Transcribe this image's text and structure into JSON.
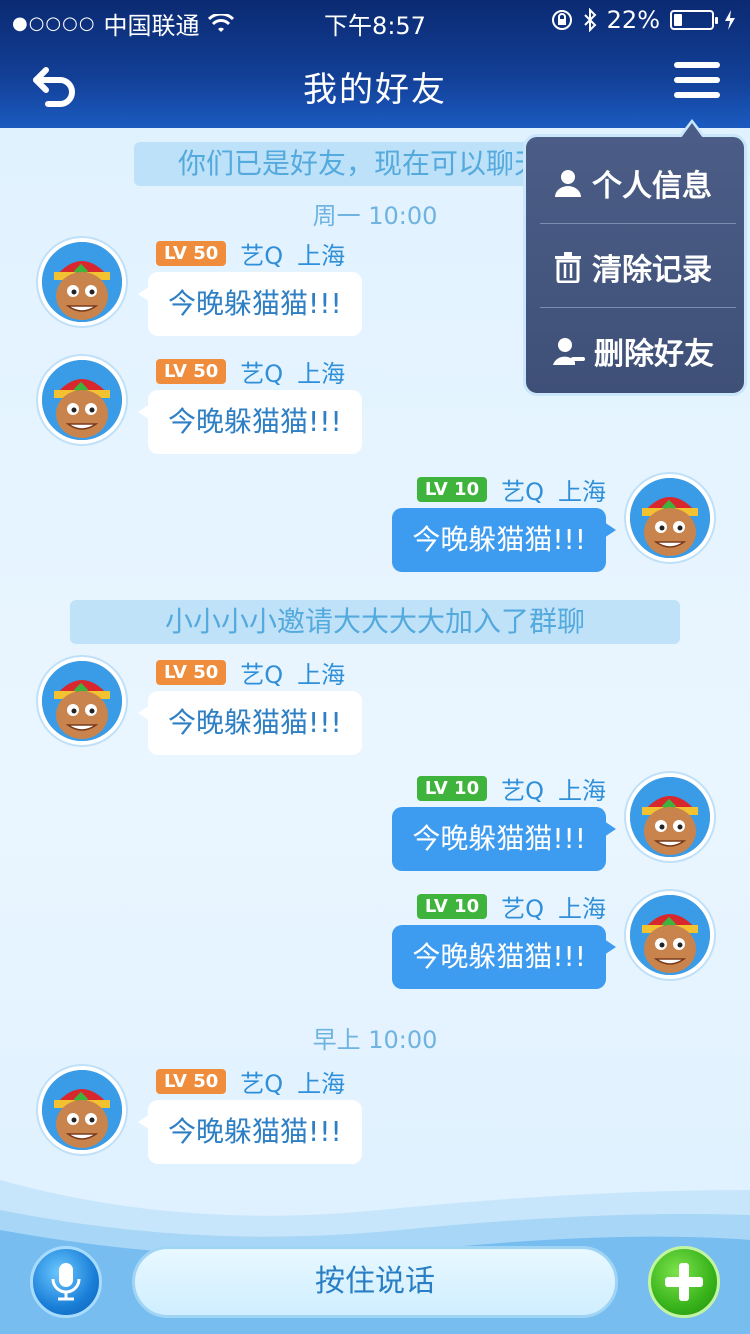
{
  "status_bar": {
    "signal_dots": "●○○○○",
    "carrier": "中国联通",
    "time": "下午8:57",
    "battery_text": "22%",
    "battery_level": 0.22,
    "icons": [
      "wifi-icon",
      "rotation-lock-icon",
      "bluetooth-icon",
      "battery-icon",
      "charging-icon"
    ]
  },
  "header": {
    "title": "我的好友",
    "back_icon": "back-arrow-icon",
    "menu_icon": "menu-icon"
  },
  "chat": {
    "system_banner_friends": "你们已是好友，现在可以聊天了",
    "time_1": "周一 10:00",
    "system_banner_invite": "小小小小邀请大大大大加入了群聊",
    "time_2": "早上 10:00",
    "messages": [
      {
        "side": "left",
        "level": "LV 50",
        "name": "艺Q",
        "city": "上海",
        "text": "今晚躲猫猫!!!"
      },
      {
        "side": "left",
        "level": "LV 50",
        "name": "艺Q",
        "city": "上海",
        "text": "今晚躲猫猫!!!"
      },
      {
        "side": "right",
        "level": "LV 10",
        "name": "艺Q",
        "city": "上海",
        "text": "今晚躲猫猫!!!"
      },
      {
        "side": "left",
        "level": "LV 50",
        "name": "艺Q",
        "city": "上海",
        "text": "今晚躲猫猫!!!"
      },
      {
        "side": "right",
        "level": "LV 10",
        "name": "艺Q",
        "city": "上海",
        "text": "今晚躲猫猫!!!"
      },
      {
        "side": "right",
        "level": "LV 10",
        "name": "艺Q",
        "city": "上海",
        "text": "今晚躲猫猫!!!"
      },
      {
        "side": "left",
        "level": "LV 50",
        "name": "艺Q",
        "city": "上海",
        "text": "今晚躲猫猫!!!"
      }
    ]
  },
  "popup_menu": {
    "items": [
      {
        "label": "个人信息",
        "icon": "person-icon"
      },
      {
        "label": "清除记录",
        "icon": "trash-icon"
      },
      {
        "label": "删除好友",
        "icon": "remove-friend-icon"
      }
    ]
  },
  "bottom_bar": {
    "talk_label": "按住说话",
    "mic_icon": "microphone-icon",
    "plus_icon": "plus-icon"
  },
  "colors": {
    "header_bg": "#123f96",
    "level_high": "#f08d3c",
    "level_low": "#3fb43c",
    "bubble_self": "#3e9cf0",
    "bubble_other": "#ffffff",
    "name_text": "#2f8fd8"
  }
}
